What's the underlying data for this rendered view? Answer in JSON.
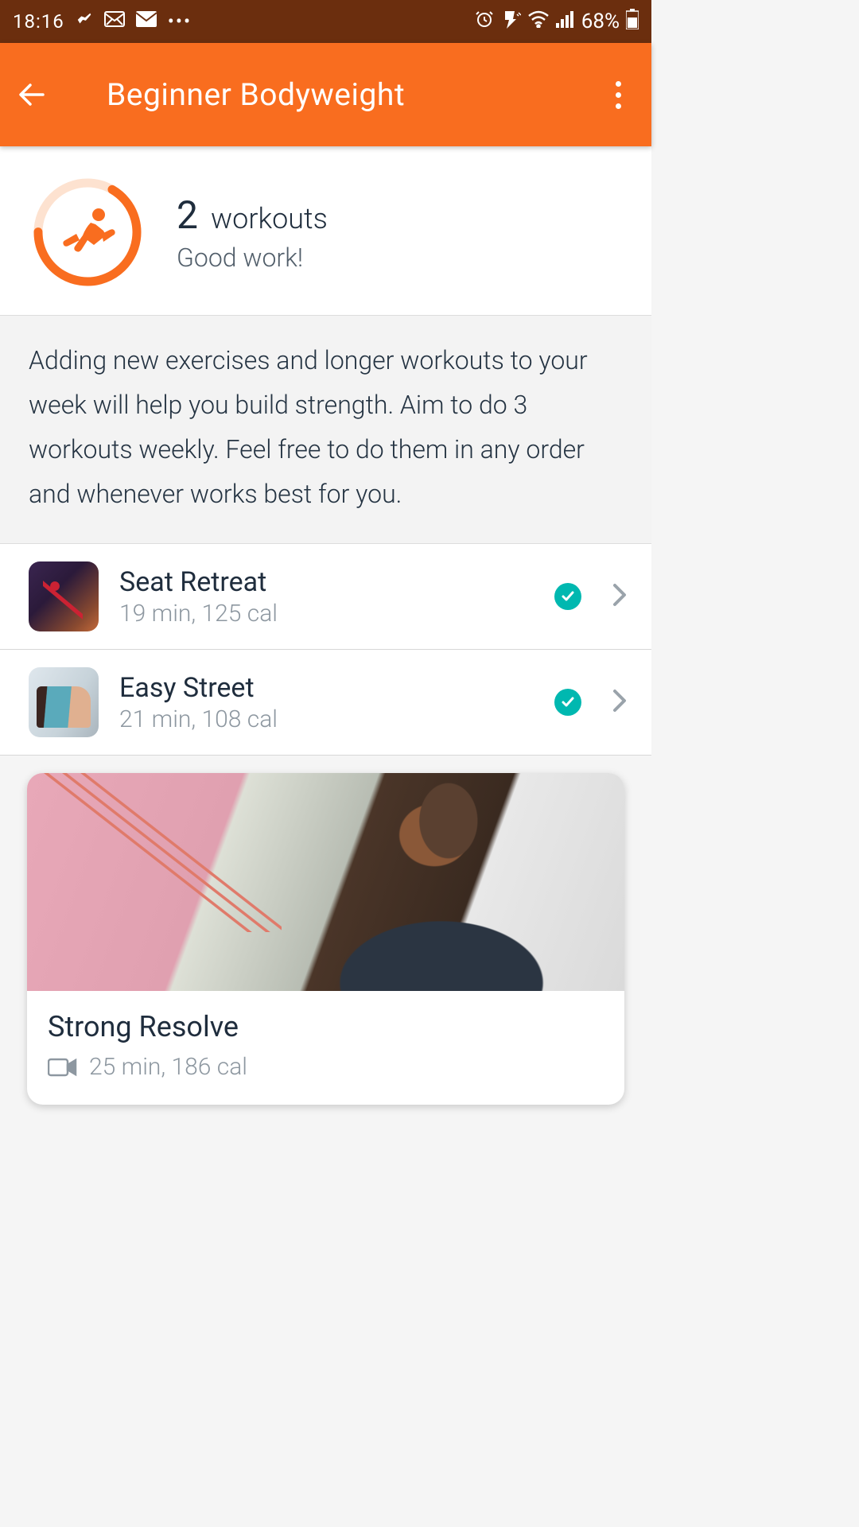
{
  "status_bar": {
    "time": "18:16",
    "battery": "68%"
  },
  "header": {
    "title": "Beginner Bodyweight"
  },
  "summary": {
    "count": "2",
    "count_label": "workouts",
    "message": "Good work!"
  },
  "description": "Adding new exercises and longer workouts to your week will help you build strength. Aim to do 3 workouts weekly. Feel free to do them in any order and whenever works best for you.",
  "workouts": [
    {
      "name": "Seat Retreat",
      "meta": "19 min, 125 cal",
      "completed": true
    },
    {
      "name": "Easy Street",
      "meta": "21 min, 108 cal",
      "completed": true
    }
  ],
  "featured": {
    "title": "Strong Resolve",
    "meta": "25 min, 186 cal"
  }
}
